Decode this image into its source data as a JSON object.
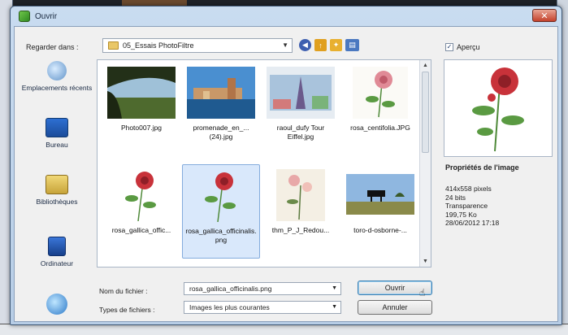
{
  "window": {
    "title": "Ouvrir",
    "close_glyph": "✕"
  },
  "toolbar": {
    "look_in_label": "Regarder dans :",
    "look_in_value": "05_Essais PhotoFiltre",
    "icons": [
      "back-icon",
      "up-folder-icon",
      "new-folder-icon",
      "view-menu-icon"
    ]
  },
  "places": [
    {
      "label": "Emplacements récents",
      "icon": "recent-places-icon"
    },
    {
      "label": "Bureau",
      "icon": "desktop-icon"
    },
    {
      "label": "Bibliothèques",
      "icon": "libraries-icon"
    },
    {
      "label": "Ordinateur",
      "icon": "computer-icon"
    },
    {
      "label": "",
      "icon": "network-icon"
    }
  ],
  "files": [
    {
      "name": "Photo007.jpg",
      "selected": false
    },
    {
      "name": "promenade_en_...(24).jpg",
      "selected": false
    },
    {
      "name": "raoul_dufy Tour Eiffel.jpg",
      "selected": false
    },
    {
      "name": "rosa_centifolia.JPG",
      "selected": false
    },
    {
      "name": "rosa_gallica_offic...",
      "selected": false
    },
    {
      "name": "rosa_gallica_officinalis.png",
      "selected": true
    },
    {
      "name": "thm_P_J_Redou...",
      "selected": false
    },
    {
      "name": "toro-d-osborne-...",
      "selected": false
    }
  ],
  "preview": {
    "checkbox_label": "Aperçu",
    "checked": true,
    "props_title": "Propriétés de l'image",
    "props": [
      "414x558 pixels",
      "24 bits",
      "Transparence",
      "199,75 Ko",
      "28/06/2012 17:18"
    ]
  },
  "bottom": {
    "filename_label": "Nom du fichier :",
    "filename_value": "rosa_gallica_officinalis.png",
    "filetype_label": "Types de fichiers :",
    "filetype_value": "Images les plus courantes",
    "open_label": "Ouvrir",
    "cancel_label": "Annuler"
  },
  "colors": {
    "accent": "#3c7fb1",
    "selection": "#d9e8fb",
    "rose": "#c8323a",
    "leaf": "#4f8a3a"
  }
}
